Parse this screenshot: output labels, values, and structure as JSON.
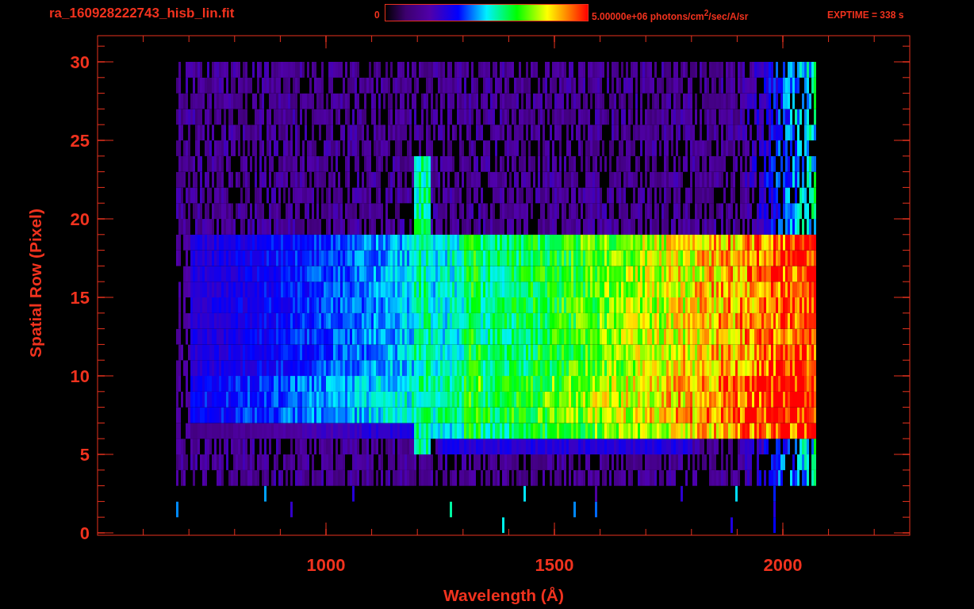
{
  "title": "ra_160928222743_hisb_lin.fit",
  "colorbar": {
    "min_label": "0",
    "max_label": "5.00000e+06 photons/cm$^{2}$/sec/A/sr"
  },
  "exposure": "EXPTIME = 338 s",
  "plot": {
    "xlabel": "Wavelength (Å)",
    "ylabel": "Spatial Row (Pixel)",
    "xticks": [
      "1000",
      "1500",
      "2000"
    ],
    "yticks": [
      "30",
      "25",
      "20",
      "15",
      "10",
      "5",
      "0"
    ]
  }
}
